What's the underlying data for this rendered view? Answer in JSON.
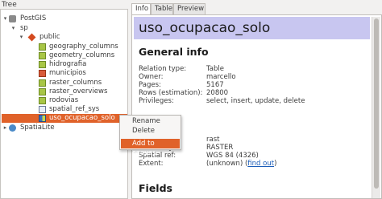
{
  "tree": {
    "title": "Tree",
    "items": [
      {
        "label": "PostGIS",
        "icon": "database-icon"
      },
      {
        "label": "sp",
        "icon": "connection-arrow"
      },
      {
        "label": "public",
        "icon": "schema-icon"
      },
      {
        "label": "geography_columns",
        "icon": "table-icon"
      },
      {
        "label": "geometry_columns",
        "icon": "table-icon"
      },
      {
        "label": "hidrografia",
        "icon": "table-icon"
      },
      {
        "label": "municipios",
        "icon": "table-icon"
      },
      {
        "label": "raster_columns",
        "icon": "table-icon"
      },
      {
        "label": "raster_overviews",
        "icon": "table-icon"
      },
      {
        "label": "rodovias",
        "icon": "table-icon"
      },
      {
        "label": "spatial_ref_sys",
        "icon": "table-icon"
      },
      {
        "label": "uso_ocupacao_solo",
        "icon": "raster-icon"
      },
      {
        "label": "SpatiaLite",
        "icon": "spatialite-icon"
      }
    ]
  },
  "context_menu": {
    "rename": "Rename",
    "delete": "Delete",
    "add_to_canvas": "Add to canvas"
  },
  "tabs": {
    "info": "Info",
    "table": "Table",
    "preview": "Preview"
  },
  "info": {
    "title": "uso_ocupacao_solo",
    "general_heading": "General info",
    "relation_type_label": "Relation type:",
    "relation_type": "Table",
    "owner_label": "Owner:",
    "owner": "marcello",
    "pages_label": "Pages:",
    "pages": "5167",
    "rows_label": "Rows (estimation):",
    "rows": "20800",
    "privileges_label": "Privileges:",
    "privileges": "select, insert, update, delete",
    "column_value": "rast",
    "geometry_label": "Geometry:",
    "geometry": "RASTER",
    "spatial_ref_label": "Spatial ref:",
    "spatial_ref": "WGS 84 (4326)",
    "extent_label": "Extent:",
    "extent": "(unknown)",
    "find_out": "find out",
    "fields_heading": "Fields"
  },
  "colors": {
    "selection": "#e0622a",
    "title_bar": "#c8c6f0"
  }
}
